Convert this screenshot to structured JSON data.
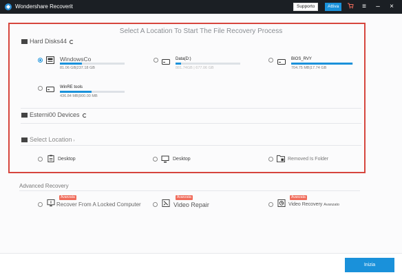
{
  "titlebar": {
    "app_name": "Wondershare Recoverit",
    "support_label": "Supporto",
    "activate_label": "Attiva"
  },
  "heading": "Select A Location To Start The File Recovery Process",
  "hard_disks": {
    "title": "Hard Disks44",
    "drives": [
      {
        "name": "WindowsCo",
        "size": "81.06 GB|237.18 GB",
        "usage": 0.34,
        "selected": true
      },
      {
        "name": "Data(D:)",
        "size": "881.74GB | 677.06 GB",
        "usage": 0.08,
        "selected": false
      },
      {
        "name": "BIOS_RVY",
        "size": "704.75 MB|17.74 GB",
        "usage": 0.99,
        "selected": false
      },
      {
        "name": "WinRE tools",
        "size": "436.84 MB|900.00 MB",
        "usage": 0.49,
        "selected": false
      }
    ]
  },
  "external": {
    "title": "Esterni00 Devices"
  },
  "select_location": {
    "title": "Select Location",
    "items": [
      {
        "label": "Desktop"
      },
      {
        "label": "Desktop"
      },
      {
        "label": "Removed Is Folder"
      }
    ]
  },
  "advanced": {
    "title": "Advanced Recovery",
    "items": [
      {
        "label": "Recover From A Locked Computer",
        "badge": "Avanzata"
      },
      {
        "label": "Video Repair",
        "badge": "Avanzata"
      },
      {
        "label": "Video Recovery",
        "suffix": "Avanzato",
        "badge": "Avanzata"
      }
    ]
  },
  "footer": {
    "start_label": "Inizia"
  },
  "colors": {
    "accent": "#1a91da",
    "highlight_frame": "#d6453d",
    "titlebar": "#1b1f24",
    "badge": "#f06b5a"
  }
}
